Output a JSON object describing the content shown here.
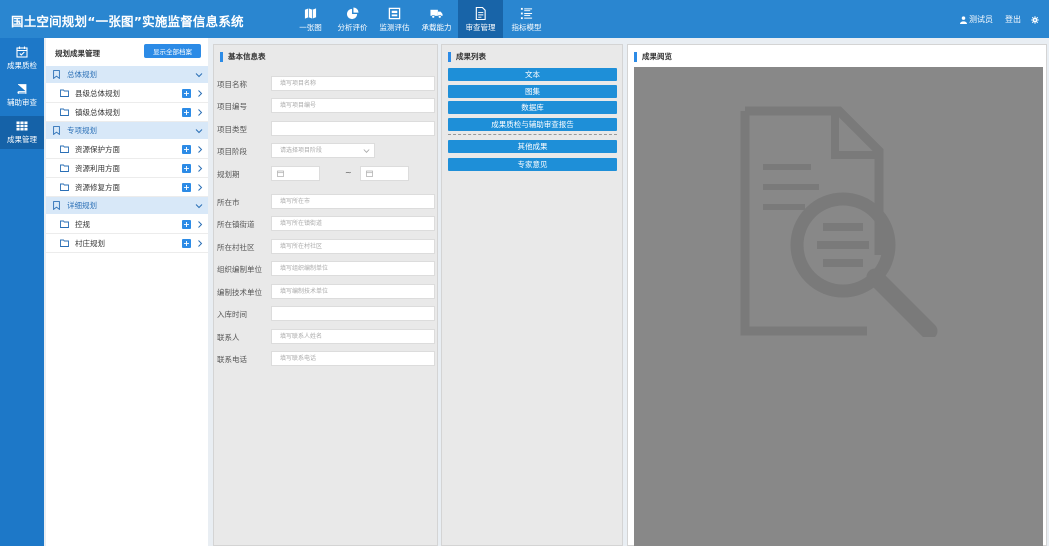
{
  "header": {
    "title": "国土空间规划“一张图”实施监督信息系统",
    "nav": [
      {
        "label": "一张图",
        "icon": "map-icon"
      },
      {
        "label": "分析评价",
        "icon": "pie-chart-icon"
      },
      {
        "label": "监测评估",
        "icon": "monitor-icon"
      },
      {
        "label": "承载能力",
        "icon": "truck-icon"
      },
      {
        "label": "审查管理",
        "icon": "document-icon"
      },
      {
        "label": "指标模型",
        "icon": "list-icon"
      }
    ],
    "user_name": "测试员",
    "logout_label": "登出"
  },
  "sidebar": {
    "items": [
      {
        "label": "成果质检",
        "icon": "calendar-check-icon"
      },
      {
        "label": "辅助审查",
        "icon": "book-icon"
      },
      {
        "label": "成果管理",
        "icon": "table-icon"
      }
    ]
  },
  "tree": {
    "title": "规划成果管理",
    "show_all_label": "显示全部档案",
    "groups": [
      {
        "label": "总体规划",
        "children": [
          "县级总体规划",
          "镇级总体规划"
        ]
      },
      {
        "label": "专项规划",
        "children": [
          "资源保护方面",
          "资源利用方面",
          "资源修复方面"
        ]
      },
      {
        "label": "详细规划",
        "children": [
          "控规",
          "村庄规划"
        ]
      }
    ]
  },
  "info_form": {
    "title": "基本信息表",
    "project_name_label": "项目名称",
    "project_name_placeholder": "填写项目名称",
    "project_code_label": "项目编号",
    "project_code_placeholder": "填写项目编号",
    "project_type_label": "项目类型",
    "project_stage_label": "项目阶段",
    "project_stage_placeholder": "请选择项目阶段",
    "plan_period_label": "规划期",
    "range_separator": "~",
    "city_label": "所在市",
    "city_placeholder": "填写所在市",
    "town_label": "所在镇街道",
    "town_placeholder": "填写所在镇街道",
    "village_label": "所在村社区",
    "village_placeholder": "填写所在村社区",
    "org_label": "组织编制单位",
    "org_placeholder": "填写组织编制单位",
    "tech_label": "编制技术单位",
    "tech_placeholder": "填写编制技术单位",
    "storage_time_label": "入库时间",
    "contact_label": "联系人",
    "contact_placeholder": "填写联系人姓名",
    "phone_label": "联系电话",
    "phone_placeholder": "填写联系电话"
  },
  "results_list": {
    "title": "成果列表",
    "buttons": [
      "文本",
      "图集",
      "数据库",
      "成果质检与辅助审查报告"
    ],
    "extra_buttons": [
      "其他成果",
      "专家意见"
    ]
  },
  "preview": {
    "title": "成果阅览",
    "icon": "document-search-icon"
  },
  "colors": {
    "header_blue": "#2a86d0",
    "active_nav": "#1864a8",
    "sidebar_blue": "#1d78c8",
    "button_blue": "#1e8fd8",
    "preview_gray": "#888888"
  }
}
